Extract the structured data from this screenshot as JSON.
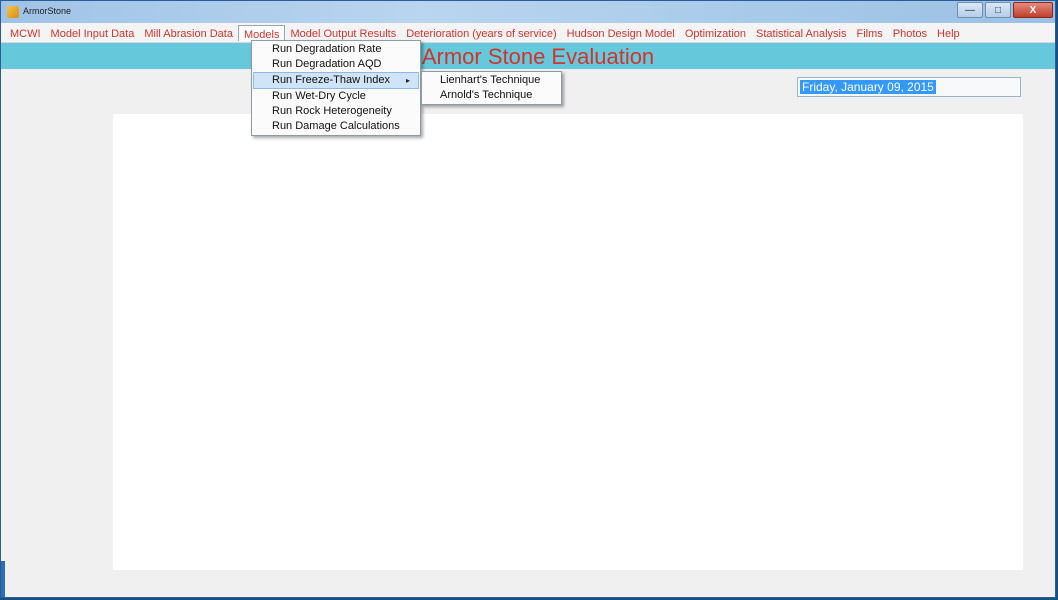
{
  "window": {
    "title": "ArmorStone",
    "controls": {
      "minimize": "—",
      "maximize": "□",
      "close": "X"
    }
  },
  "menubar": {
    "items": [
      "MCWI",
      "Model Input Data",
      "Mill Abrasion Data",
      "Models",
      "Model Output Results",
      "Deterioration (years of service)",
      "Hudson Design Model",
      "Optimization",
      "Statistical Analysis",
      "Films",
      "Photos",
      "Help"
    ],
    "active": "Models"
  },
  "header": {
    "title": "Armor Stone Evaluation",
    "band_color": "#65c8db",
    "title_color": "#d2342c"
  },
  "models_menu": {
    "items": [
      "Run Degradation Rate",
      "Run Degradation AQD",
      "Run Freeze-Thaw Index",
      "Run Wet-Dry Cycle",
      "Run Rock Heterogeneity",
      "Run Damage Calculations"
    ],
    "highlighted": "Run Freeze-Thaw Index",
    "submenu_arrow": "▸"
  },
  "freeze_thaw_submenu": {
    "items": [
      "Lienhart's Technique",
      "Arnold's Technique"
    ]
  },
  "date_field": {
    "value": "Friday, January 09, 2015"
  },
  "colors": {
    "accent_text": "#d2342c",
    "selection": "#3399ff",
    "menu_highlight": "#cfe4f7"
  }
}
